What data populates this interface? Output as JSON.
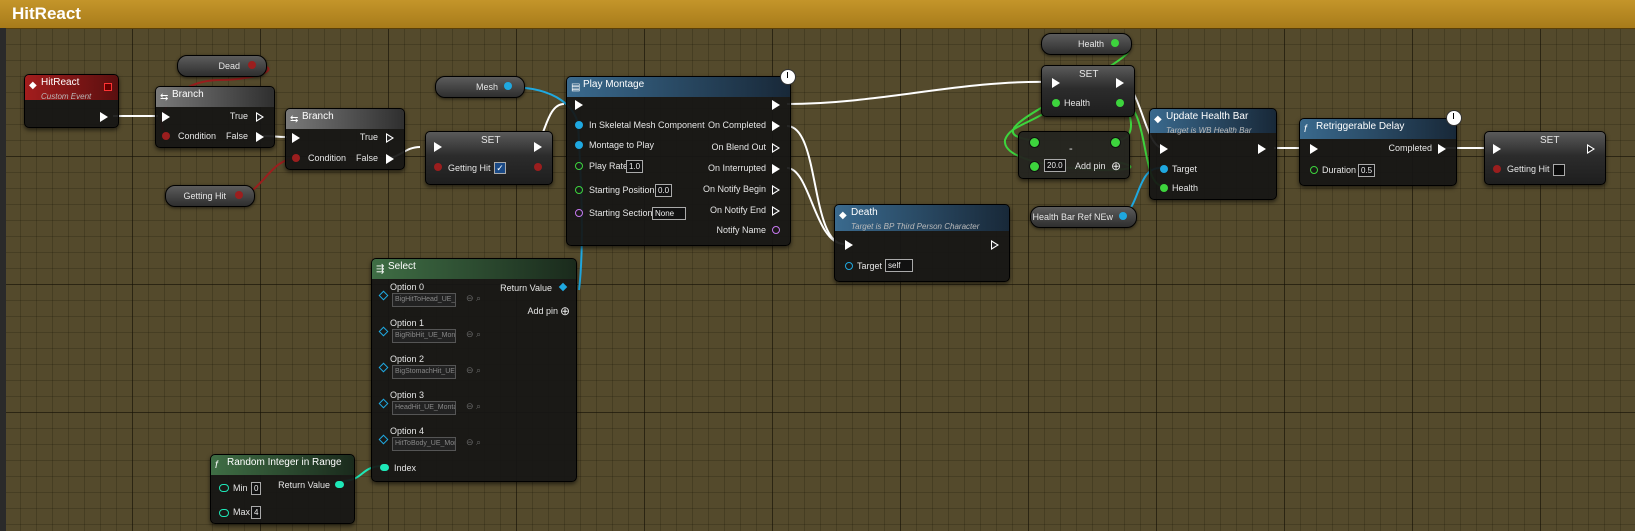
{
  "graph": {
    "title": "HitReact"
  },
  "vars": {
    "dead": "Dead",
    "getting_hit": "Getting Hit",
    "mesh": "Mesh",
    "health": "Health",
    "health_bar_ref": "Health Bar Ref NEw"
  },
  "hitreact": {
    "title": "HitReact",
    "subtitle": "Custom Event"
  },
  "branch1": {
    "title": "Branch",
    "true": "True",
    "false": "False",
    "condition": "Condition"
  },
  "branch2": {
    "title": "Branch",
    "true": "True",
    "false": "False",
    "condition": "Condition"
  },
  "set1": {
    "title": "SET",
    "pin": "Getting Hit",
    "checked": true
  },
  "montage": {
    "title": "Play Montage",
    "inputs": [
      "In Skeletal Mesh Component",
      "Montage to Play",
      "Play Rate",
      "Starting Position",
      "Starting Section"
    ],
    "play_rate": "1.0",
    "starting_position": "0.0",
    "starting_section": "None",
    "outputs": [
      "On Completed",
      "On Blend Out",
      "On Interrupted",
      "On Notify Begin",
      "On Notify End",
      "Notify Name"
    ]
  },
  "select": {
    "title": "Select",
    "return_value": "Return Value",
    "add_pin": "Add pin",
    "index": "Index",
    "options": [
      {
        "label": "Option 0",
        "value": "BigHitToHead_UE_Mo"
      },
      {
        "label": "Option 1",
        "value": "BigRibHit_UE_Mont"
      },
      {
        "label": "Option 2",
        "value": "BigStomachHit_UE_"
      },
      {
        "label": "Option 3",
        "value": "HeadHit_UE_Monta"
      },
      {
        "label": "Option 4",
        "value": "HitToBody_UE_Mon"
      }
    ]
  },
  "randint": {
    "title": "Random Integer in Range",
    "min": "Min",
    "min_val": "0",
    "max": "Max",
    "max_val": "4",
    "return_value": "Return Value"
  },
  "death": {
    "title": "Death",
    "subtitle": "Target is BP Third Person Character",
    "target": "Target",
    "target_val": "self"
  },
  "set2": {
    "title": "SET",
    "pin": "Health"
  },
  "subtract": {
    "symbol": "-",
    "val": "20.0",
    "add_pin": "Add pin"
  },
  "update": {
    "title": "Update Health Bar",
    "subtitle": "Target is WB Health Bar",
    "target": "Target",
    "health": "Health"
  },
  "delay": {
    "title": "Retriggerable Delay",
    "completed": "Completed",
    "duration": "Duration",
    "duration_val": "0.5"
  },
  "set3": {
    "title": "SET",
    "pin": "Getting Hit",
    "checked": false
  },
  "colors": {
    "exec": "#ffffff",
    "bool": "#9b1e1e",
    "object": "#1fa8e0",
    "float": "#3dd43d",
    "int": "#1ee8b8",
    "name": "#c678f0",
    "titlebar": "#b8891f"
  }
}
